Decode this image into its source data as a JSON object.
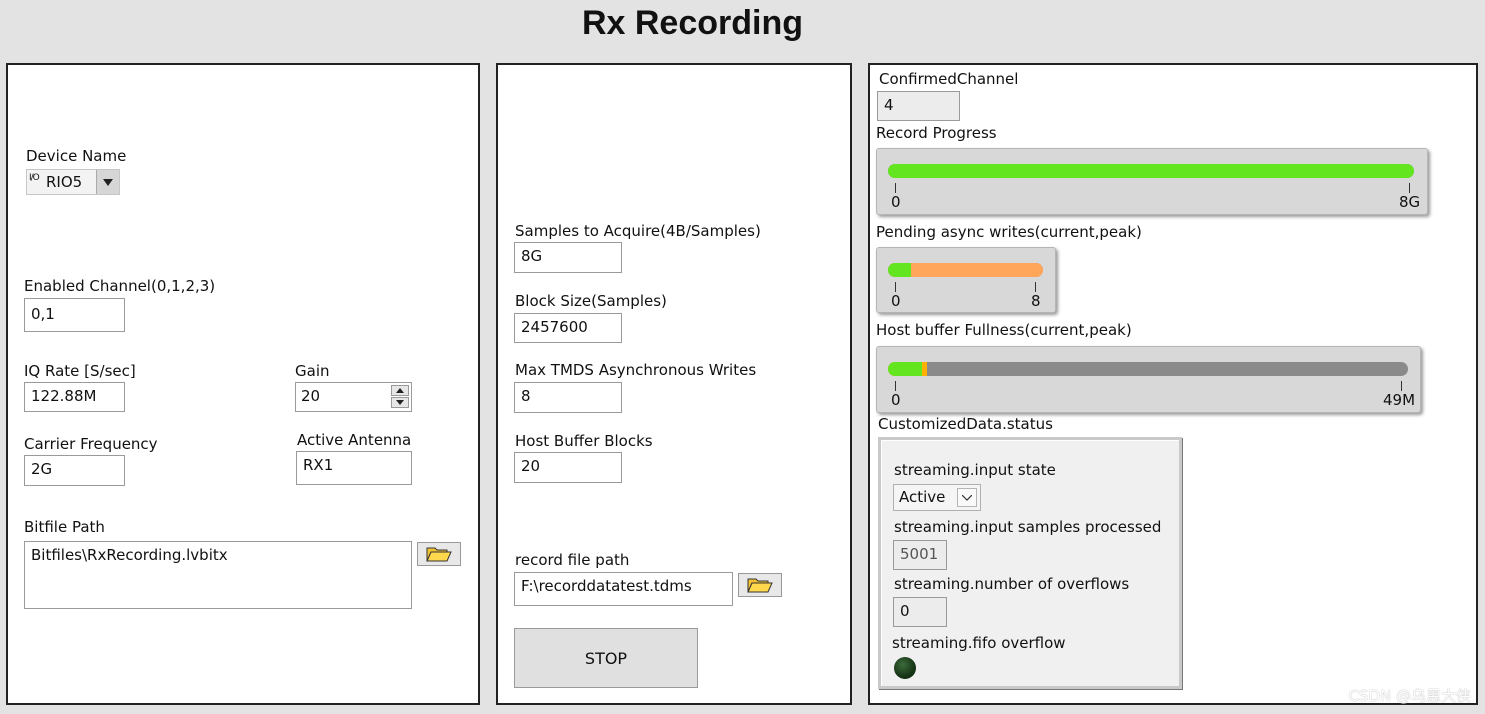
{
  "title": "Rx Recording",
  "left_panel": {
    "device_name_label": "Device Name",
    "device_name_prefix": "I/O",
    "device_name_value": "RIO5",
    "enabled_channel_label": "Enabled Channel(0,1,2,3)",
    "enabled_channel_value": "0,1",
    "iq_rate_label": "IQ Rate [S/sec]",
    "iq_rate_value": "122.88M",
    "gain_label": "Gain",
    "gain_value": "20",
    "carrier_frequency_label": "Carrier Frequency",
    "carrier_frequency_value": "2G",
    "active_antenna_label": "Active Antenna",
    "active_antenna_value": "RX1",
    "bitfile_path_label": "Bitfile Path",
    "bitfile_path_value": "Bitfiles\\RxRecording.lvbitx"
  },
  "middle_panel": {
    "samples_label": "Samples to Acquire(4B/Samples)",
    "samples_value": "8G",
    "block_size_label": "Block Size(Samples)",
    "block_size_value": "2457600",
    "max_writes_label": "Max TMDS Asynchronous Writes",
    "max_writes_value": "8",
    "host_buffer_label": "Host Buffer Blocks",
    "host_buffer_value": "20",
    "record_path_label": "record file path",
    "record_path_value": "F:\\recorddatatest.tdms",
    "stop_label": "STOP"
  },
  "right_panel": {
    "confirmed_channel_label": "ConfirmedChannel",
    "confirmed_channel_value": "4",
    "record_progress": {
      "label": "Record Progress",
      "min_label": "0",
      "max_label": "8G",
      "fill_fraction": 1.0,
      "color": "#63e620"
    },
    "pending_writes": {
      "label": "Pending async writes(current,peak)",
      "min_label": "0",
      "max_label": "8",
      "current_fraction": 0.15,
      "peak_fraction": 1.0,
      "current_color": "#63e620",
      "peak_color": "#ffa65a"
    },
    "host_buffer": {
      "label": "Host buffer Fullness(current,peak)",
      "min_label": "0",
      "max_label": "49M",
      "current_fraction": 0.065,
      "peak_fraction": 0.075,
      "current_color": "#63e620",
      "peak_color": "#ffb000"
    },
    "status": {
      "cluster_label": "CustomizedData.status",
      "input_state_label": "streaming.input state",
      "input_state_value": "Active",
      "samples_processed_label": "streaming.input samples processed",
      "samples_processed_value": "5001",
      "overflows_label": "streaming.number of overflows",
      "overflows_value": "0",
      "fifo_overflow_label": "streaming.fifo overflow"
    }
  },
  "watermark": "CSDN @乌恩大侠"
}
